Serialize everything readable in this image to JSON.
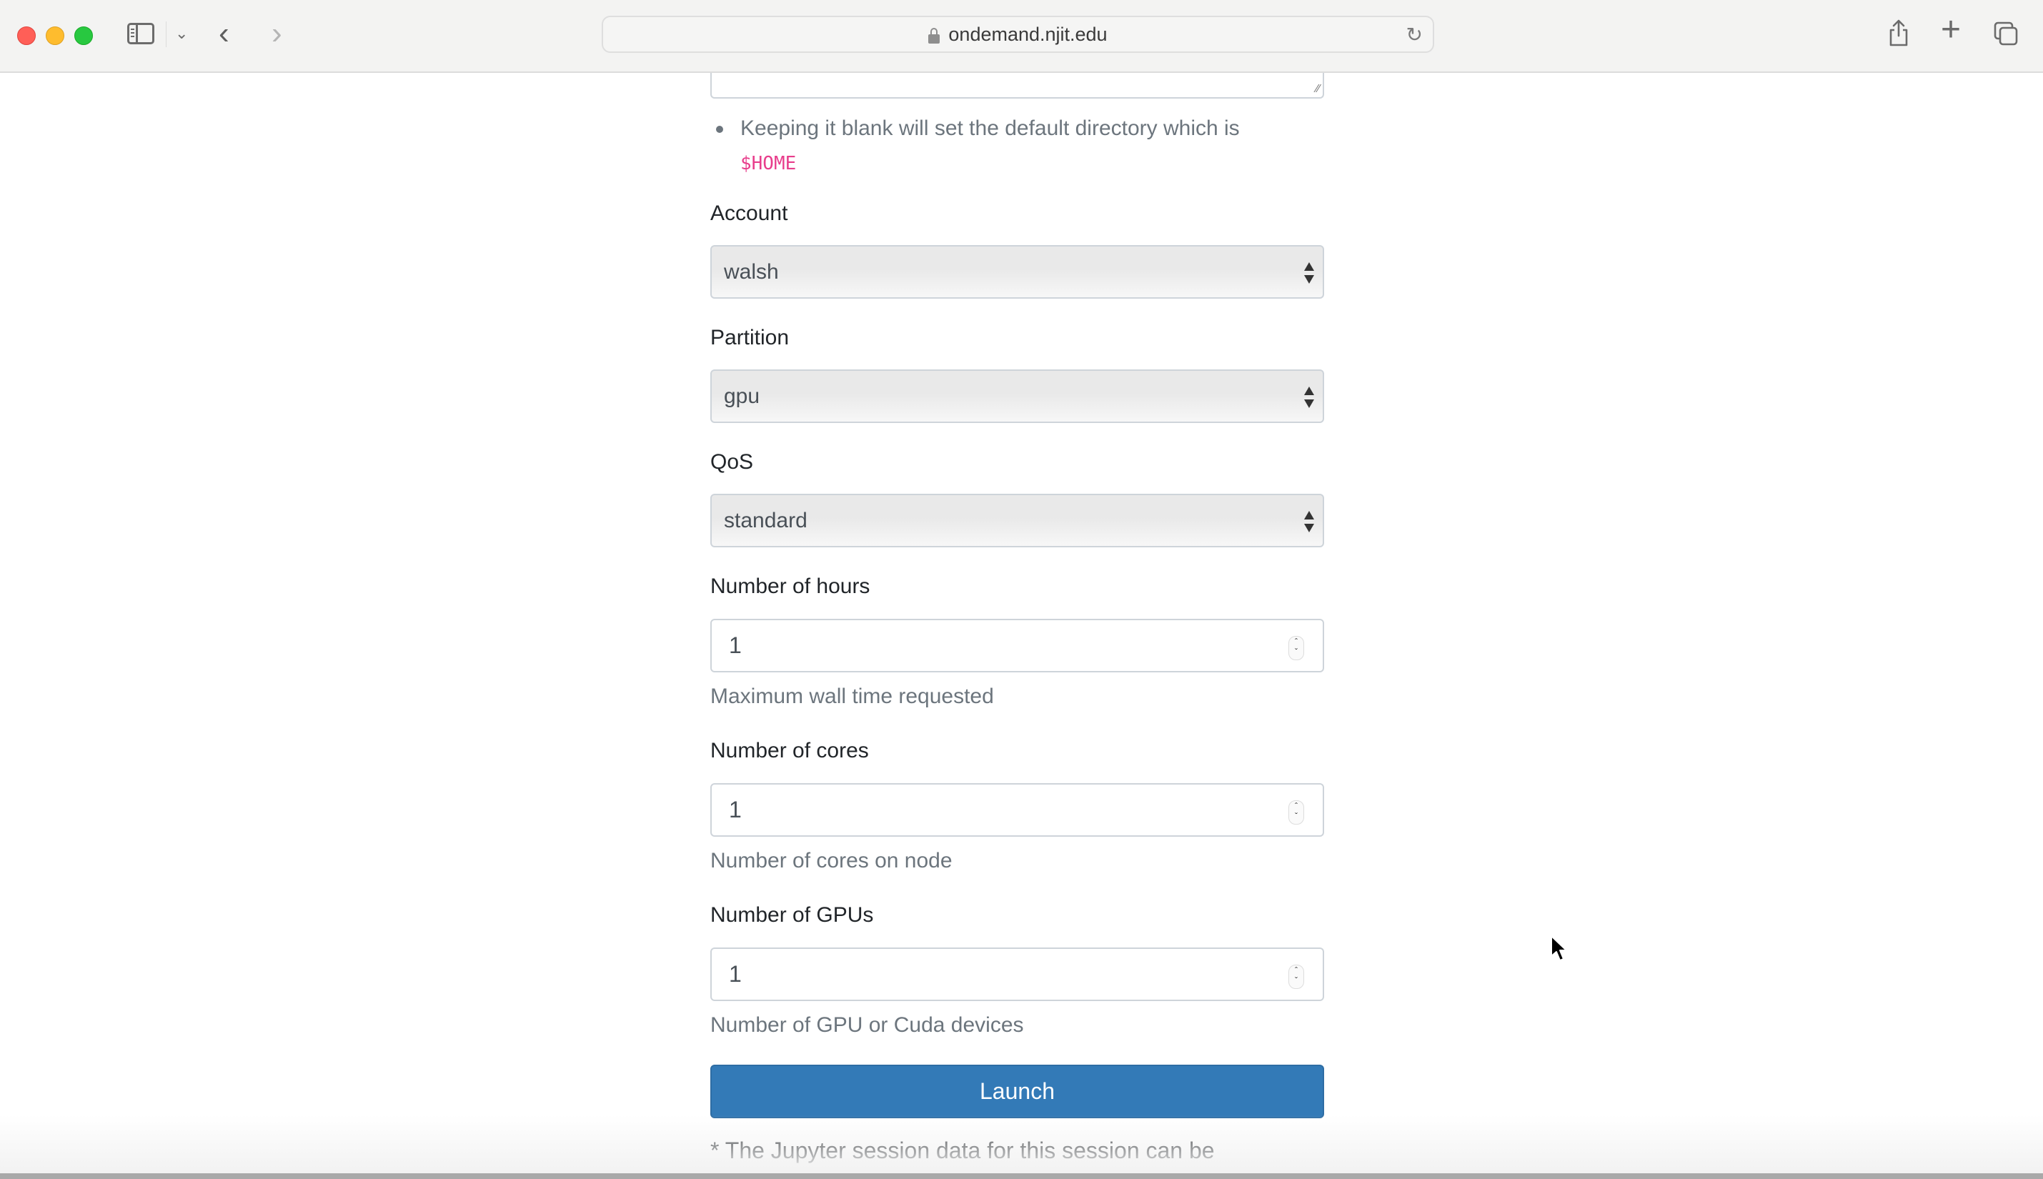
{
  "browser": {
    "url": "ondemand.njit.edu",
    "icons": {
      "close": "traffic-close",
      "minimize": "traffic-minimize",
      "zoom": "traffic-zoom",
      "sidebar": "sidebar-icon",
      "tab_groups_dropdown": "chevron-down-icon",
      "back": "chevron-left-icon",
      "forward": "chevron-right-icon",
      "lock": "lock-icon",
      "reload": "reload-icon",
      "share": "share-icon",
      "new_tab": "plus-icon",
      "tab_overview": "tabs-icon"
    }
  },
  "form": {
    "working_dir_help": {
      "text": "Keeping it blank will set the default directory which is",
      "code": "$HOME"
    },
    "account": {
      "label": "Account",
      "value": "walsh"
    },
    "partition": {
      "label": "Partition",
      "value": "gpu"
    },
    "qos": {
      "label": "QoS",
      "value": "standard"
    },
    "hours": {
      "label": "Number of hours",
      "value": "1",
      "help": "Maximum wall time requested"
    },
    "cores": {
      "label": "Number of cores",
      "value": "1",
      "help": "Number of cores on node"
    },
    "gpus": {
      "label": "Number of GPUs",
      "value": "1",
      "help": "Number of GPU or Cuda devices"
    },
    "launch_label": "Launch",
    "footer_note": "* The Jupyter session data for this session can be"
  },
  "colors": {
    "primary_button": "#337ab7",
    "code_text": "#e83e8c",
    "help_text": "#6c757d"
  }
}
